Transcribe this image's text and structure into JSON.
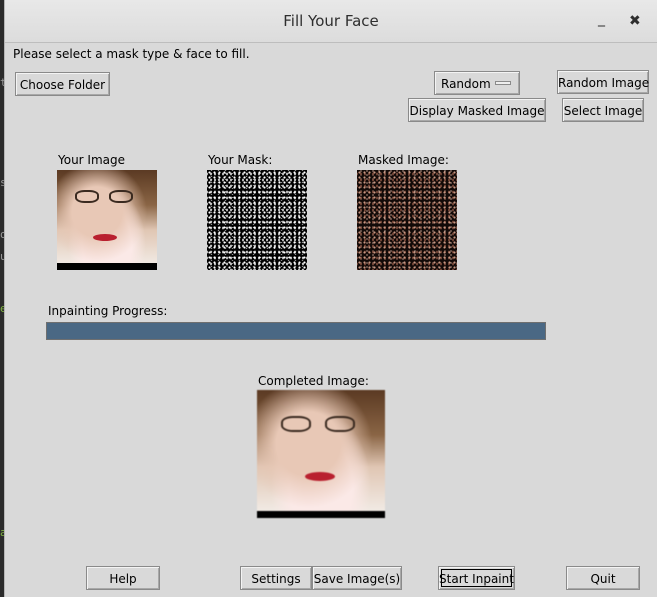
{
  "window": {
    "title": "Fill Your Face",
    "minimize_symbol": "_",
    "close_symbol": "✖"
  },
  "background_text": [
    "t",
    "s",
    "o",
    "u",
    "e",
    "a"
  ],
  "instructions": "Please select a mask type & face to fill.",
  "buttons": {
    "choose_folder": "Choose Folder",
    "random_image": "Random Image",
    "display_masked_image": "Display Masked Image",
    "select_image": "Select Image",
    "help": "Help",
    "settings": "Settings",
    "save_images": "Save Image(s)",
    "start_inpaint": "Start Inpaint",
    "quit": "Quit"
  },
  "mask_type": {
    "selected": "Random"
  },
  "panels": {
    "your_image_label": "Your Image",
    "your_mask_label": "Your Mask:",
    "masked_image_label": "Masked Image:",
    "completed_image_label": "Completed Image:"
  },
  "progress": {
    "label": "Inpainting Progress:",
    "fraction": 1.0,
    "fill_color": "#4a6884"
  },
  "icons": {
    "minimize": "minimize-icon",
    "close": "close-icon",
    "dropdown_indicator": "option-menu-indicator-icon"
  }
}
